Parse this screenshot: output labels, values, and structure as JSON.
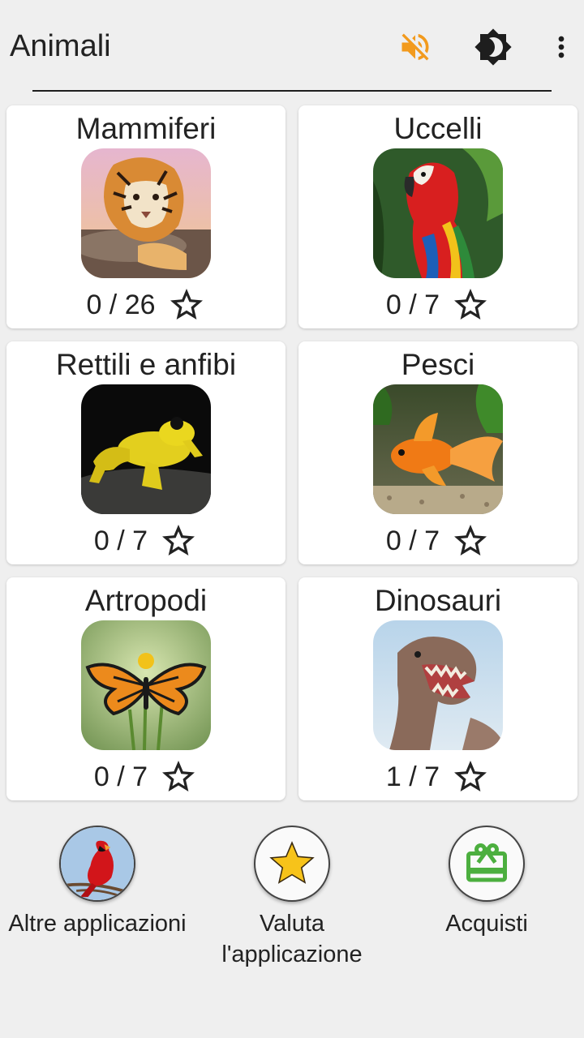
{
  "appbar": {
    "title": "Animali",
    "sound_icon_color": "#f29a1d"
  },
  "categories": [
    {
      "title": "Mammiferi",
      "progress": "0 / 26",
      "image": "tiger"
    },
    {
      "title": "Uccelli",
      "progress": "0 / 7",
      "image": "parrot"
    },
    {
      "title": "Rettili e anfibi",
      "progress": "0 / 7",
      "image": "frog"
    },
    {
      "title": "Pesci",
      "progress": "0 / 7",
      "image": "goldfish"
    },
    {
      "title": "Artropodi",
      "progress": "0 / 7",
      "image": "butterfly"
    },
    {
      "title": "Dinosauri",
      "progress": "1 / 7",
      "image": "dinosaur"
    }
  ],
  "bottom": {
    "other_apps_label": "Altre applicazioni",
    "rate_label": "Valuta l'applicazione",
    "purchases_label": "Acquisti"
  },
  "colors": {
    "background": "#efefef",
    "card": "#ffffff",
    "rate_star": "#f7c31a",
    "gift": "#4caf3f"
  }
}
